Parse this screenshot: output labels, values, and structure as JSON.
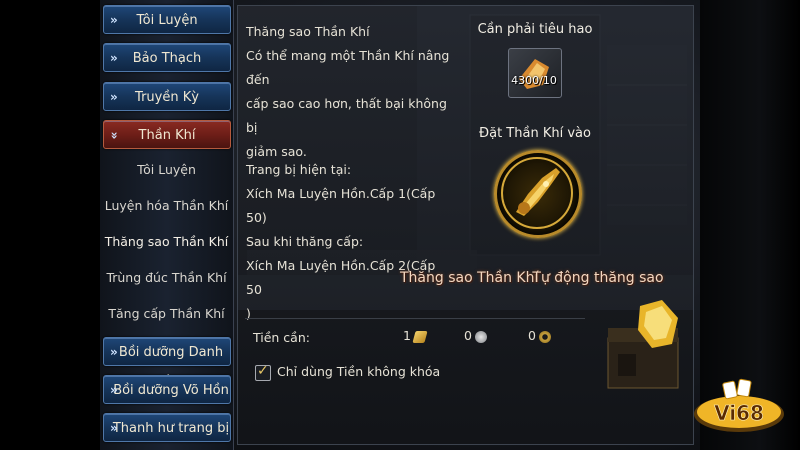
{
  "menu": {
    "items": [
      {
        "label": "Tôi Luyện",
        "arrow": "»"
      },
      {
        "label": "Bảo Thạch",
        "arrow": "»"
      },
      {
        "label": "Truyền Kỳ",
        "arrow": "»"
      },
      {
        "label": "Thần Khí",
        "arrow": "»",
        "active": true
      }
    ],
    "subitems": [
      {
        "label": "Tôi Luyện"
      },
      {
        "label": "Luyện hóa Thần Khí"
      },
      {
        "label": "Thăng sao Thần Khí",
        "selected": true
      },
      {
        "label": "Trùng đúc Thần Khí"
      },
      {
        "label": "Tăng cấp Thần Khí"
      }
    ],
    "bottom_items": [
      {
        "label": "Bồi dưỡng Danh Bài",
        "arrow": "»"
      },
      {
        "label": "Bồi dưỡng Võ Hồn",
        "arrow": "»"
      },
      {
        "label": "Thanh hư trang bị",
        "arrow": "»"
      }
    ]
  },
  "description": {
    "title": "Thăng sao Thần Khí",
    "line1": "Có thể mang một Thần Khí nâng đến",
    "line2": "cấp sao cao hơn, thất bại không bị",
    "line3": "giảm sao."
  },
  "equipment": {
    "current_label": "Trang bị hiện tại:",
    "current_value": "Xích Ma Luyện Hồn.Cấp 1(Cấp 50)",
    "after_label": "Sau khi thăng cấp:",
    "after_value": "Xích Ma Luyện Hồn.Cấp 2(Cấp 50",
    "after_value_cont": ")"
  },
  "cost": {
    "label": "Cần phải tiêu hao",
    "count": "4300/10"
  },
  "slot": {
    "label": "Đặt Thần Khí vào"
  },
  "actions": {
    "upgrade_label": "Thăng sao Thần Khí",
    "auto_label": "Tự động thăng sao"
  },
  "money": {
    "label": "Tiền cần:",
    "values": [
      "1",
      "0",
      "0"
    ]
  },
  "checkbox": {
    "label": "Chỉ dùng Tiền không khóa",
    "checked": true
  },
  "logo": {
    "text": "Vi68"
  },
  "colors": {
    "menu_button": "#163459",
    "menu_active": "#6b1d17",
    "gold": "#d6a93a",
    "text": "#e6e2d6"
  }
}
